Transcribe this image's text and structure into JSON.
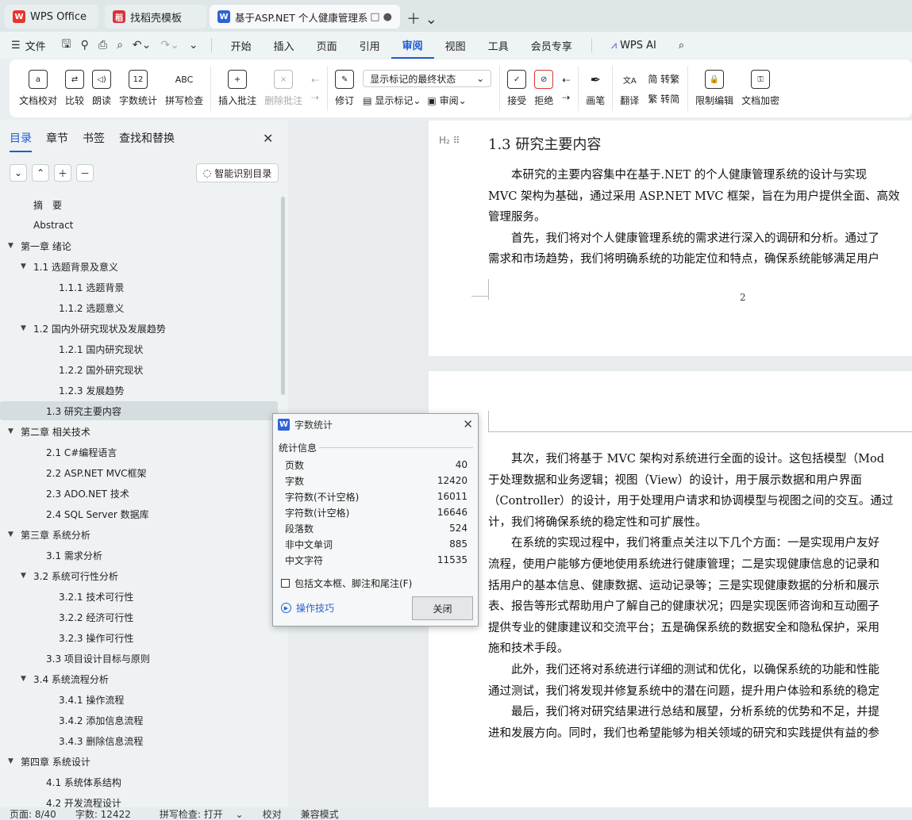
{
  "tabs": [
    {
      "label": "WPS Office",
      "icon": "wps-logo-icon"
    },
    {
      "label": "找稻壳模板",
      "icon": "docer-icon"
    },
    {
      "label": "基于ASP.NET 个人健康管理系",
      "icon": "writer-icon"
    }
  ],
  "menu": {
    "file": "文件",
    "items": [
      "开始",
      "插入",
      "页面",
      "引用",
      "审阅",
      "视图",
      "工具",
      "会员专享"
    ],
    "active": "审阅",
    "wps_ai": "WPS AI"
  },
  "ribbon": {
    "doc_proof": "文档校对",
    "compare": "比较",
    "read_aloud": "朗读",
    "word_count": "字数统计",
    "spell_check": "拼写检查",
    "insert_comment": "插入批注",
    "delete_comment": "删除批注",
    "revise": "修订",
    "markup_select": "显示标记的最终状态",
    "show_markup": "显示标记",
    "review": "审阅",
    "accept": "接受",
    "reject": "拒绝",
    "ink": "画笔",
    "translate": "翻译",
    "to_traditional": "简 转繁",
    "to_simplified": "繁 转简",
    "restrict_edit": "限制编辑",
    "doc_encrypt": "文档加密",
    "word_count_icon_text": "12",
    "spell_icon_text": "ABC"
  },
  "navpane": {
    "tabs": [
      "目录",
      "章节",
      "书签",
      "查找和替换"
    ],
    "smart_btn": "智能识别目录",
    "toc": [
      {
        "label": "摘　要",
        "level": 0,
        "arrow": ""
      },
      {
        "label": "Abstract",
        "level": 0,
        "arrow": ""
      },
      {
        "label": "第一章  绪论",
        "level": 0,
        "arrow": "▼"
      },
      {
        "label": "1.1  选题背景及意义",
        "level": 1,
        "arrow": "▼"
      },
      {
        "label": "1.1.1  选题背景",
        "level": 2,
        "arrow": ""
      },
      {
        "label": "1.1.2  选题意义",
        "level": 2,
        "arrow": ""
      },
      {
        "label": "1.2  国内外研究现状及发展趋势",
        "level": 1,
        "arrow": "▼"
      },
      {
        "label": "1.2.1  国内研究现状",
        "level": 2,
        "arrow": ""
      },
      {
        "label": "1.2.2  国外研究现状",
        "level": 2,
        "arrow": ""
      },
      {
        "label": "1.2.3  发展趋势",
        "level": 2,
        "arrow": ""
      },
      {
        "label": "1.3  研究主要内容",
        "level": 1,
        "arrow": "",
        "selected": true
      },
      {
        "label": "第二章  相关技术",
        "level": 0,
        "arrow": "▼"
      },
      {
        "label": "2.1 C#编程语言",
        "level": 1,
        "arrow": ""
      },
      {
        "label": "2.2 ASP.NET MVC框架",
        "level": 1,
        "arrow": ""
      },
      {
        "label": "2.3 ADO.NET 技术",
        "level": 1,
        "arrow": ""
      },
      {
        "label": "2.4 SQL Server 数据库",
        "level": 1,
        "arrow": ""
      },
      {
        "label": "第三章  系统分析",
        "level": 0,
        "arrow": "▼"
      },
      {
        "label": "3.1  需求分析",
        "level": 1,
        "arrow": ""
      },
      {
        "label": "3.2  系统可行性分析",
        "level": 1,
        "arrow": "▼"
      },
      {
        "label": "3.2.1  技术可行性",
        "level": 2,
        "arrow": ""
      },
      {
        "label": "3.2.2  经济可行性",
        "level": 2,
        "arrow": ""
      },
      {
        "label": "3.2.3  操作可行性",
        "level": 2,
        "arrow": ""
      },
      {
        "label": "3.3  项目设计目标与原则",
        "level": 1,
        "arrow": ""
      },
      {
        "label": "3.4 系统流程分析",
        "level": 1,
        "arrow": "▼"
      },
      {
        "label": "3.4.1 操作流程",
        "level": 2,
        "arrow": ""
      },
      {
        "label": "3.4.2 添加信息流程",
        "level": 2,
        "arrow": ""
      },
      {
        "label": "3.4.3 删除信息流程",
        "level": 2,
        "arrow": ""
      },
      {
        "label": "第四章  系统设计",
        "level": 0,
        "arrow": "▼"
      },
      {
        "label": "4.1  系统体系结构",
        "level": 1,
        "arrow": ""
      },
      {
        "label": "4.2 开发流程设计",
        "level": 1,
        "arrow": ""
      }
    ]
  },
  "document": {
    "heading": "1.3  研究主要内容",
    "heading_marker": "H₂ ⠿",
    "page1_lines": [
      "　　本研究的主要内容集中在基于.NET 的个人健康管理系统的设计与实现",
      "MVC 架构为基础，通过采用 ASP.NET MVC 框架，旨在为用户提供全面、高效",
      "管理服务。",
      "　　首先，我们将对个人健康管理系统的需求进行深入的调研和分析。通过了",
      "需求和市场趋势，我们将明确系统的功能定位和特点，确保系统能够满足用户"
    ],
    "page_number": "2",
    "page2_lines": [
      "　　其次，我们将基于 MVC 架构对系统进行全面的设计。这包括模型（Mod",
      "于处理数据和业务逻辑；视图（View）的设计，用于展示数据和用户界面",
      "（Controller）的设计，用于处理用户请求和协调模型与视图之间的交互。通过",
      "计，我们将确保系统的稳定性和可扩展性。",
      "　　在系统的实现过程中，我们将重点关注以下几个方面：一是实现用户友好",
      "流程，使用户能够方便地使用系统进行健康管理；二是实现健康信息的记录和",
      "括用户的基本信息、健康数据、运动记录等；三是实现健康数据的分析和展示",
      "表、报告等形式帮助用户了解自己的健康状况；四是实现医师咨询和互动圈子",
      "提供专业的健康建议和交流平台；五是确保系统的数据安全和隐私保护，采用",
      "施和技术手段。",
      "　　此外，我们还将对系统进行详细的测试和优化，以确保系统的功能和性能",
      "通过测试，我们将发现并修复系统中的潜在问题，提升用户体验和系统的稳定",
      "　　最后，我们将对研究结果进行总结和展望，分析系统的优势和不足，并提",
      "进和发展方向。同时，我们也希望能够为相关领域的研究和实践提供有益的参"
    ]
  },
  "dialog": {
    "title": "字数统计",
    "section": "统计信息",
    "stats": [
      {
        "label": "页数",
        "value": "40"
      },
      {
        "label": "字数",
        "value": "12420"
      },
      {
        "label": "字符数(不计空格)",
        "value": "16011"
      },
      {
        "label": "字符数(计空格)",
        "value": "16646"
      },
      {
        "label": "段落数",
        "value": "524"
      },
      {
        "label": "非中文单词",
        "value": "885"
      },
      {
        "label": "中文字符",
        "value": "11535"
      }
    ],
    "checkbox": "包括文本框、脚注和尾注(F)",
    "tips": "操作技巧",
    "close": "关闭"
  },
  "status": {
    "page": "页面: 8/40",
    "words": "字数: 12422",
    "spell": "拼写检查: 打开",
    "proof": "校对",
    "compat": "兼容模式"
  },
  "colors": {
    "accent": "#1e5bd6",
    "wps_red": "#e8352d",
    "word_blue": "#2f62d8"
  }
}
